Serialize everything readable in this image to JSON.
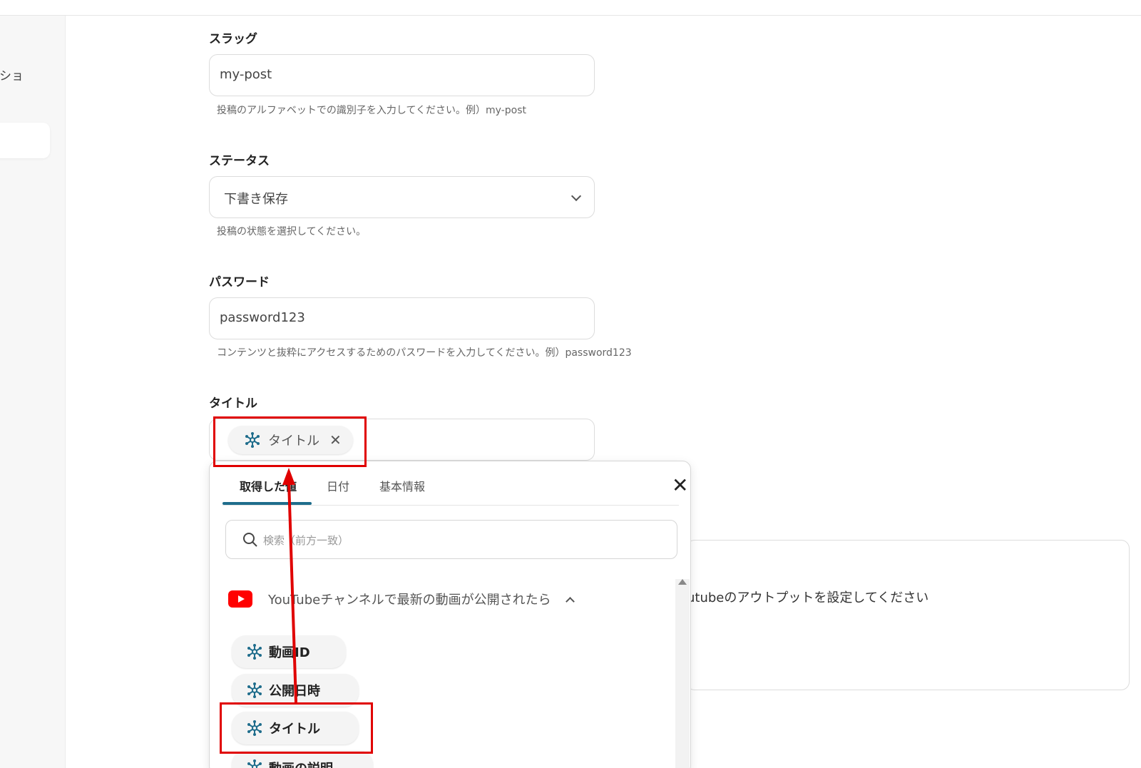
{
  "sidebar": {
    "partial_label": "クショ"
  },
  "form": {
    "slug": {
      "label": "スラッグ",
      "value": "my-post",
      "helper": "投稿のアルファベットでの識別子を入力してください。例）my-post"
    },
    "status": {
      "label": "ステータス",
      "value": "下書き保存",
      "helper": "投稿の状態を選択してください。"
    },
    "password": {
      "label": "パスワード",
      "value": "password123",
      "helper": "コンテンツと抜粋にアクセスするためのパスワードを入力してください。例）password123"
    },
    "title": {
      "label": "タイトル",
      "chip": "タイトル"
    }
  },
  "side_box": {
    "text": "utubeのアウトプットを設定してください"
  },
  "popup": {
    "tabs": [
      "取得した値",
      "日付",
      "基本情報"
    ],
    "search_placeholder": "検索（前方一致）",
    "group_label": "YouTubeチャンネルで最新の動画が公開されたら",
    "items": [
      "動画ID",
      "公開日時",
      "タイトル",
      "動画の説明"
    ]
  },
  "colors": {
    "accent": "#1f6d8c",
    "highlight": "#e00000",
    "youtube": "#ff0000"
  }
}
